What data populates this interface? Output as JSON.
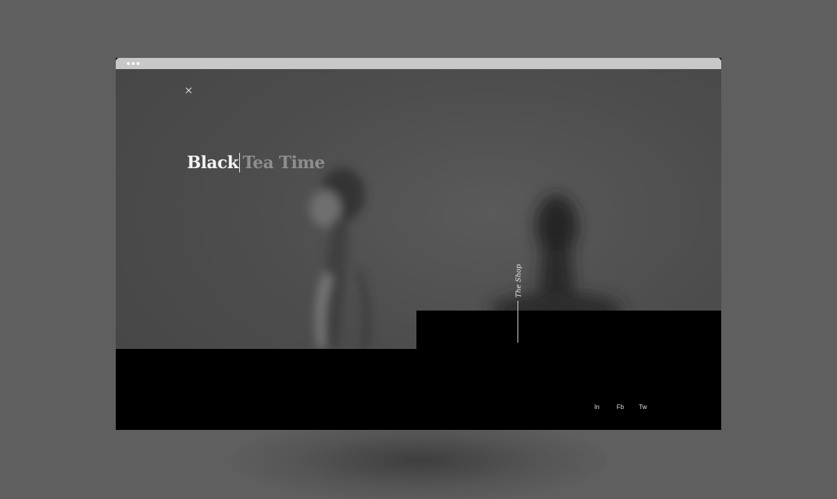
{
  "page": {
    "background_color": "#5f5f5f"
  },
  "browser": {
    "chrome_color": "#c8c8c8",
    "window_dots": 3
  },
  "header": {
    "close_icon": "close-icon"
  },
  "hero": {
    "title_bold": "Black",
    "title_light": "Tea Time",
    "title_bold_color": "#f4f4f4",
    "title_light_color": "#8e8e8e"
  },
  "shop": {
    "label": "The Shop"
  },
  "social": {
    "links": [
      {
        "label": "In"
      },
      {
        "label": "Fb"
      },
      {
        "label": "Tw"
      }
    ]
  }
}
